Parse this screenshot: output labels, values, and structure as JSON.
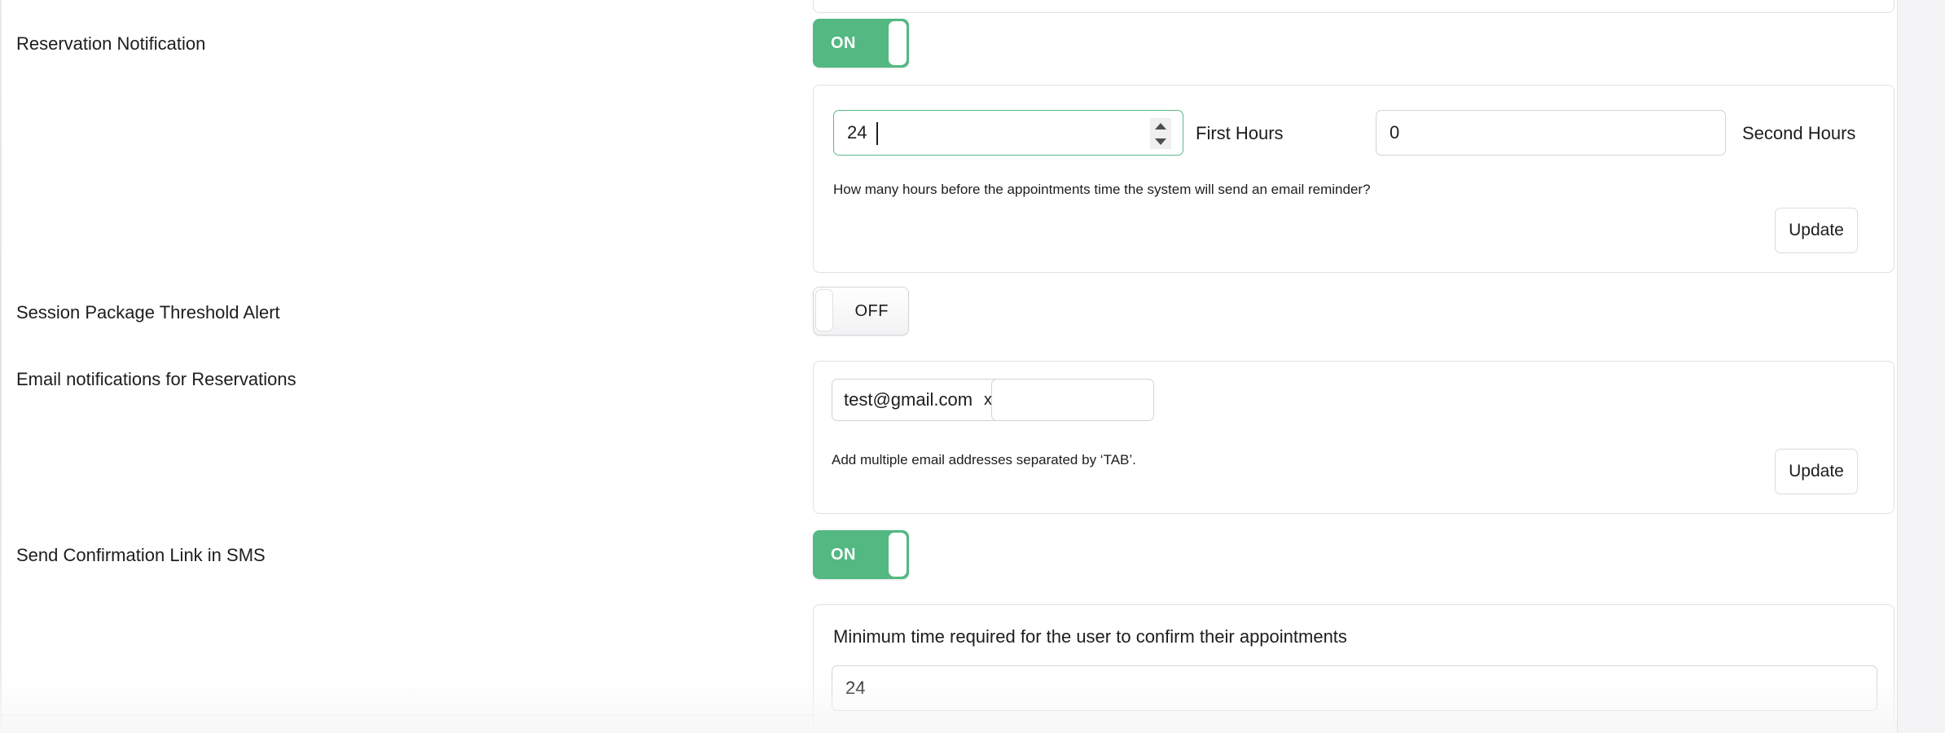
{
  "rows": [
    {
      "label": "Reservation Notification",
      "toggle": {
        "state": "ON",
        "name": "reservation-notification-toggle"
      }
    },
    {
      "label": "Session Package Threshold Alert",
      "toggle": {
        "state": "OFF",
        "name": "session-package-threshold-alert-toggle"
      }
    },
    {
      "label": "Email notifications for Reservations"
    },
    {
      "label": "Send Confirmation Link in SMS",
      "toggle": {
        "state": "ON",
        "name": "send-confirmation-link-sms-toggle"
      }
    }
  ],
  "reservation_card": {
    "first_hours_value": "24",
    "first_hours_label": "First Hours",
    "second_hours_value": "0",
    "second_hours_label": "Second Hours",
    "helper": "How many hours before the appointments time the system will send an email reminder?",
    "update_label": "Update"
  },
  "email_card": {
    "tag": "test@gmail.com",
    "tag_remove": "x",
    "new_email_value": "",
    "new_email_placeholder": "",
    "helper": "Add multiple email addresses separated by ‘TAB’.",
    "update_label": "Update"
  },
  "sms_card": {
    "heading": "Minimum time required for the user to confirm their appointments",
    "minimum_time_value": "24"
  },
  "colors": {
    "toggle_on": "#53b882",
    "focus_border": "#5cb98a",
    "card_border": "#e1e1e5",
    "text": "#1d1d1f",
    "gutter": "#f4f4f6"
  }
}
